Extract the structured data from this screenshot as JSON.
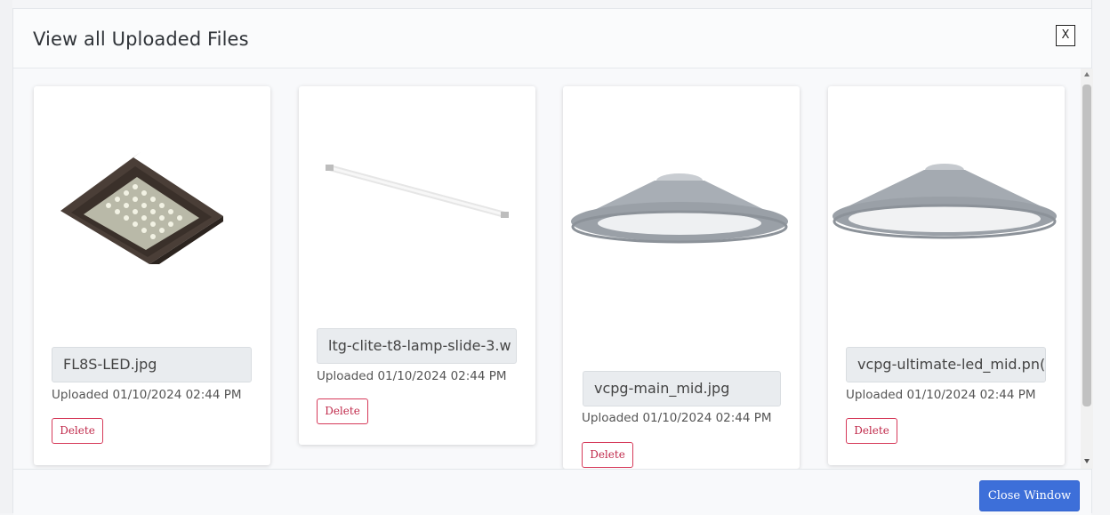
{
  "modal": {
    "title": "View all Uploaded Files",
    "close_label": "X",
    "footer": {
      "close_window_label": "Close Window"
    }
  },
  "files": [
    {
      "name": "FL8S-LED.jpg",
      "uploaded": "Uploaded 01/10/2024 02:44 PM",
      "delete_label": "Delete",
      "thumb_icon": "led-floodlight-image"
    },
    {
      "name": "ltg-clite-t8-lamp-slide-3.w",
      "uploaded": "Uploaded 01/10/2024 02:44 PM",
      "delete_label": "Delete",
      "thumb_icon": "t8-lamp-tube-image"
    },
    {
      "name": "vcpg-main_mid.jpg",
      "uploaded": "Uploaded 01/10/2024 02:44 PM",
      "delete_label": "Delete",
      "thumb_icon": "canopy-light-image"
    },
    {
      "name": "vcpg-ultimate-led_mid.pn(",
      "uploaded": "Uploaded 01/10/2024 02:44 PM",
      "delete_label": "Delete",
      "thumb_icon": "canopy-light-led-image"
    }
  ],
  "colors": {
    "delete_border": "#d63a5a",
    "primary_button": "#3d6fd9"
  }
}
